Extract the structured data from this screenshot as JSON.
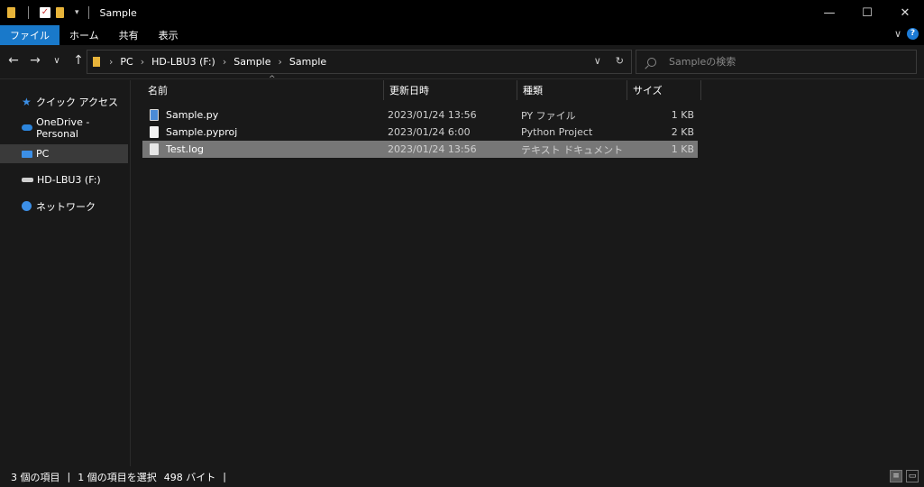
{
  "window": {
    "title": "Sample"
  },
  "ribbon": {
    "tabs": [
      "ファイル",
      "ホーム",
      "共有",
      "表示"
    ]
  },
  "address": {
    "crumbs": [
      "PC",
      "HD-LBU3 (F:)",
      "Sample",
      "Sample"
    ]
  },
  "search": {
    "placeholder": "Sampleの検索"
  },
  "sidebar": {
    "items": [
      {
        "label": "クイック アクセス",
        "icon": "star-icon"
      },
      {
        "label": "OneDrive - Personal",
        "icon": "cloud-icon"
      },
      {
        "label": "PC",
        "icon": "pc-icon",
        "selected": true
      },
      {
        "label": "HD-LBU3 (F:)",
        "icon": "drive-icon"
      },
      {
        "label": "ネットワーク",
        "icon": "network-icon"
      }
    ]
  },
  "columns": {
    "name": "名前",
    "date": "更新日時",
    "type": "種類",
    "size": "サイズ"
  },
  "files": [
    {
      "name": "Sample.py",
      "date": "2023/01/24 13:56",
      "type": "PY ファイル",
      "size": "1 KB",
      "icon": "python-file-icon"
    },
    {
      "name": "Sample.pyproj",
      "date": "2023/01/24 6:00",
      "type": "Python Project",
      "size": "2 KB",
      "icon": "file-icon"
    },
    {
      "name": "Test.log",
      "date": "2023/01/24 13:56",
      "type": "テキスト ドキュメント",
      "size": "1 KB",
      "icon": "text-file-icon",
      "selected": true
    }
  ],
  "status": {
    "count": "3 個の項目",
    "selection": "1 個の項目を選択",
    "size": "498 バイト"
  },
  "colors": {
    "accent": "#1979ca",
    "folder": "#e8b43a",
    "selected_row": "#777777"
  }
}
